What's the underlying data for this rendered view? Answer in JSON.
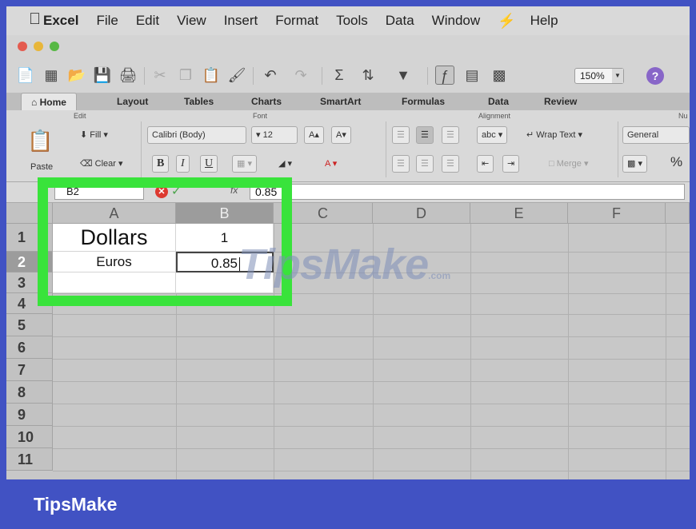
{
  "menubar": {
    "app": "Excel",
    "items": [
      "File",
      "Edit",
      "View",
      "Insert",
      "Format",
      "Tools",
      "Data",
      "Window"
    ],
    "help": "Help"
  },
  "toolbar": {
    "zoom": "150%",
    "help_glyph": "?"
  },
  "ribbon_tabs": [
    "Home",
    "Layout",
    "Tables",
    "Charts",
    "SmartArt",
    "Formulas",
    "Data",
    "Review"
  ],
  "ribbon": {
    "groups": {
      "edit": "Edit",
      "font": "Font",
      "alignment": "Alignment",
      "number": "Nu"
    },
    "paste": "Paste",
    "fill": "Fill",
    "clear": "Clear",
    "font_name": "Calibri (Body)",
    "font_size": "12",
    "bold": "B",
    "italic": "I",
    "underline": "U",
    "wrap_text": "abc",
    "wrap_text_label": "Wrap Text",
    "merge": "Merge",
    "number_format": "General",
    "percent": "%"
  },
  "formula_bar": {
    "name_box": "B2",
    "fx": "fx",
    "value": "0.85"
  },
  "sheet": {
    "columns": [
      "A",
      "B",
      "C",
      "D",
      "E",
      "F"
    ],
    "rows": [
      "1",
      "2",
      "3",
      "4",
      "5",
      "6",
      "7",
      "8",
      "9",
      "10",
      "11"
    ],
    "cells": {
      "A1": "Dollars",
      "B1": "1",
      "A2": "Euros",
      "B2": "0.85"
    }
  },
  "watermark": {
    "text": "TipsMake",
    "suffix": ".com"
  },
  "footer": {
    "brand": "TipsMake"
  }
}
